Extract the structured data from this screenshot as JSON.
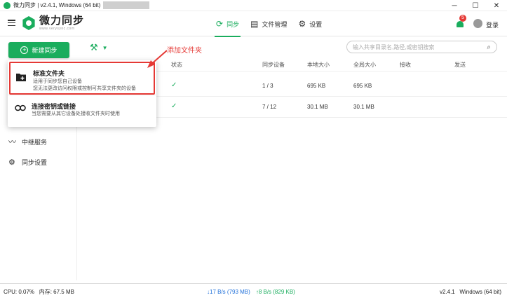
{
  "titlebar": {
    "title": "微力同步 | v2.4.1, Windows (64 bit)",
    "minimize": "─",
    "maximize": "☐",
    "close": "✕"
  },
  "header": {
    "logo_name": "微力同步",
    "logo_url": "www.verysync.com",
    "nav": [
      {
        "label": "同步",
        "icon": "sync-icon",
        "glyph": "⟳"
      },
      {
        "label": "文件管理",
        "icon": "file-icon",
        "glyph": "▤"
      },
      {
        "label": "设置",
        "icon": "gear-icon",
        "glyph": "⚙"
      }
    ],
    "notification_count": "5",
    "login_label": "登录"
  },
  "toolbar": {
    "new_sync_label": "新建同步",
    "tools_glyph": "⚒",
    "search_placeholder": "输入共享目录名,路径,或密钥搜索"
  },
  "sidebar": {
    "items": [
      {
        "label": "中继服务",
        "icon": "relay-icon",
        "glyph": "〰"
      },
      {
        "label": "同步设置",
        "icon": "gear-icon",
        "glyph": "⚙"
      }
    ]
  },
  "table": {
    "headers": [
      "状态",
      "同步设备",
      "本地大小",
      "全局大小",
      "接收",
      "发送"
    ],
    "rows": [
      {
        "status": "✓",
        "devices": "1 / 3",
        "local_size": "695 KB",
        "global_size": "695 KB"
      },
      {
        "status": "✓",
        "devices": "7 / 12",
        "local_size": "30.1 MB",
        "global_size": "30.1 MB"
      }
    ]
  },
  "dropdown": {
    "items": [
      {
        "title": "标准文件夹",
        "desc1": "适用于同步您自己设备",
        "desc2": "您无法更改访问权限或控制可共享文件夹的设备"
      },
      {
        "title": "连接密钥或链接",
        "desc1": "当您需要从其它设备处接收文件夹时使用"
      }
    ]
  },
  "annotation": {
    "text": "添加文件夹",
    "color": "#e53935"
  },
  "statusbar": {
    "cpu": "CPU: 0.07%",
    "memory": "内存: 67.5 MB",
    "download": "↓17 B/s (793 MB)",
    "upload": "↑8 B/s (829 KB)",
    "version": "v2.4.1",
    "platform": "Windows (64 bit)"
  },
  "colors": {
    "accent": "#1aad5d",
    "alert": "#e53935"
  }
}
